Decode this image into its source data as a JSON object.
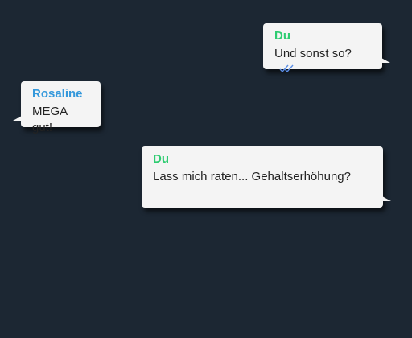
{
  "colors": {
    "background": "#1c2733",
    "bubble": "#f4f4f4",
    "self_name": "#2ecc71",
    "other_name": "#3498db",
    "read_ticks": "#5b8ee6"
  },
  "messages": [
    {
      "sender": "Du",
      "text": "Und sonst so?",
      "direction": "outgoing",
      "status_icon": "double-check-icon"
    },
    {
      "sender": "Rosaline",
      "text": "MEGA gut!",
      "direction": "incoming"
    },
    {
      "sender": "Du",
      "text": "Lass mich raten... Gehaltserhöhung?",
      "direction": "outgoing"
    }
  ]
}
